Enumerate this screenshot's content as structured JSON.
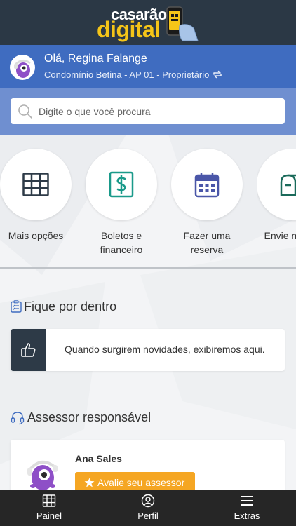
{
  "header": {
    "logo_line1": "casarão",
    "logo_line2": "digital"
  },
  "user": {
    "greeting": "Olá, Regina Falange",
    "unit": "Condomínio Betina - AP 01 - Proprietário"
  },
  "search": {
    "placeholder": "Digite o que você procura"
  },
  "quick_actions": [
    {
      "label": "Mais opções",
      "icon": "grid-icon"
    },
    {
      "label": "Boletos e financeiro",
      "icon": "dollar-icon"
    },
    {
      "label": "Fazer uma reserva",
      "icon": "calendar-icon"
    },
    {
      "label": "Envie mensa",
      "icon": "mailbox-icon"
    }
  ],
  "news": {
    "title": "Fique por dentro",
    "empty_message": "Quando surgirem novidades, exibiremos aqui."
  },
  "advisor": {
    "title": "Assessor responsável",
    "name": "Ana Sales",
    "rate_label": "Avalie seu assessor"
  },
  "nav": [
    {
      "label": "Painel",
      "icon": "grid-icon"
    },
    {
      "label": "Perfil",
      "icon": "user-icon"
    },
    {
      "label": "Extras",
      "icon": "menu-icon"
    }
  ],
  "colors": {
    "topbar": "#2b3845",
    "userbar": "#3f6cc0",
    "search_band": "#6f8fd0",
    "accent_yellow": "#f5c518",
    "rate_button": "#f5a623",
    "bottom_nav": "#262626"
  }
}
